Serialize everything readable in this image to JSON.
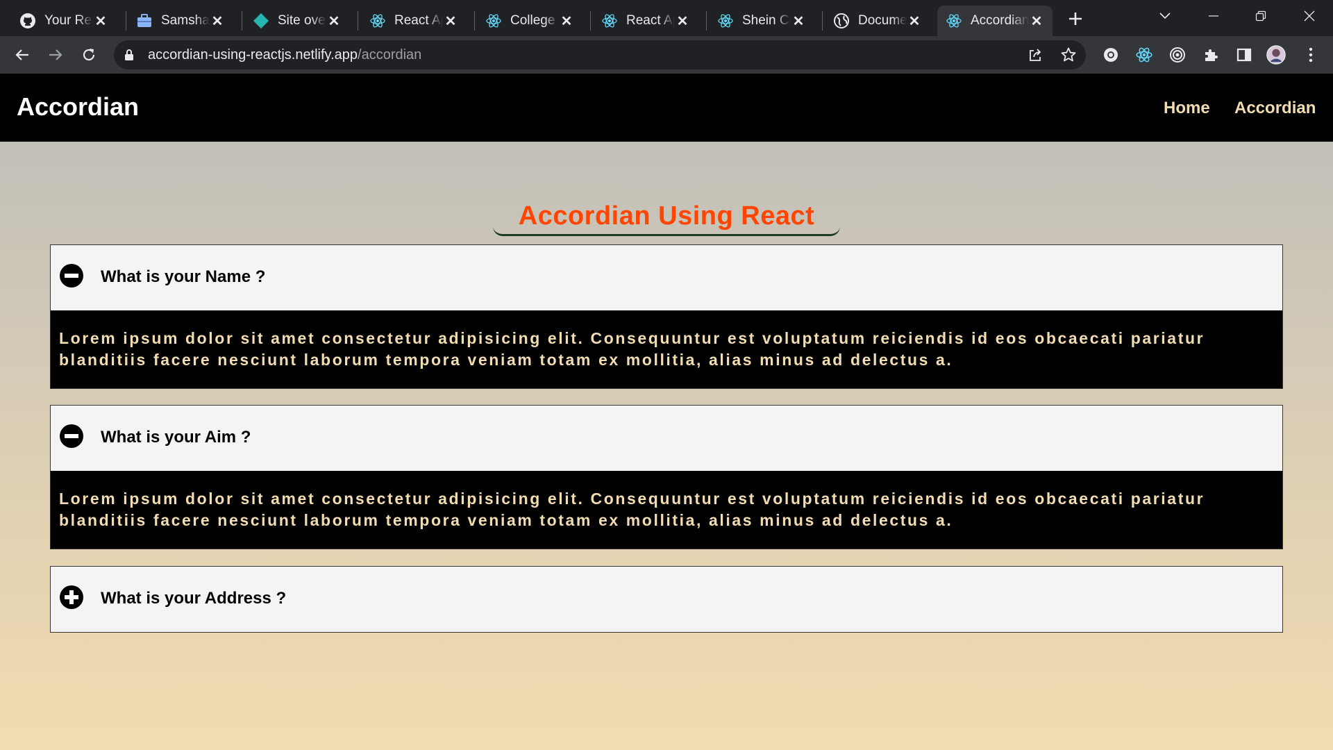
{
  "browser": {
    "tabs": [
      {
        "title": "Your Repositories",
        "icon": "github-icon"
      },
      {
        "title": "Samshad Ali",
        "icon": "briefcase-icon"
      },
      {
        "title": "Site overview",
        "icon": "netlify-icon"
      },
      {
        "title": "React App",
        "icon": "react-icon"
      },
      {
        "title": "College Project",
        "icon": "react-icon"
      },
      {
        "title": "React App",
        "icon": "react-icon"
      },
      {
        "title": "Shein Clone",
        "icon": "react-icon"
      },
      {
        "title": "Document",
        "icon": "globe-icon"
      },
      {
        "title": "Accordian",
        "icon": "react-icon",
        "active": true
      }
    ],
    "address": {
      "host": "accordian-using-reactjs.netlify.app",
      "path": "/accordian"
    }
  },
  "navbar": {
    "brand": "Accordian",
    "links": [
      "Home",
      "Accordian"
    ]
  },
  "main": {
    "heading": "Accordian Using React",
    "items": [
      {
        "question": "What is your Name ?",
        "expanded": true,
        "icon": "minus-circle-icon",
        "answer": "Lorem ipsum dolor sit amet consectetur adipisicing elit. Consequuntur est voluptatum reiciendis id eos obcaecati pariatur blanditiis facere nesciunt laborum tempora veniam totam ex mollitia, alias minus ad delectus a."
      },
      {
        "question": "What is your Aim ?",
        "expanded": true,
        "icon": "minus-circle-icon",
        "answer": "Lorem ipsum dolor sit amet consectetur adipisicing elit. Consequuntur est voluptatum reiciendis id eos obcaecati pariatur blanditiis facere nesciunt laborum tempora veniam totam ex mollitia, alias minus ad delectus a."
      },
      {
        "question": "What is your Address ?",
        "expanded": false,
        "icon": "plus-circle-icon"
      }
    ]
  },
  "colors": {
    "navbar_bg": "#000000",
    "nav_link": "#f2dcb1",
    "heading": "#ff4500",
    "answer_bg": "#000000",
    "answer_text": "#f2dcb1"
  }
}
